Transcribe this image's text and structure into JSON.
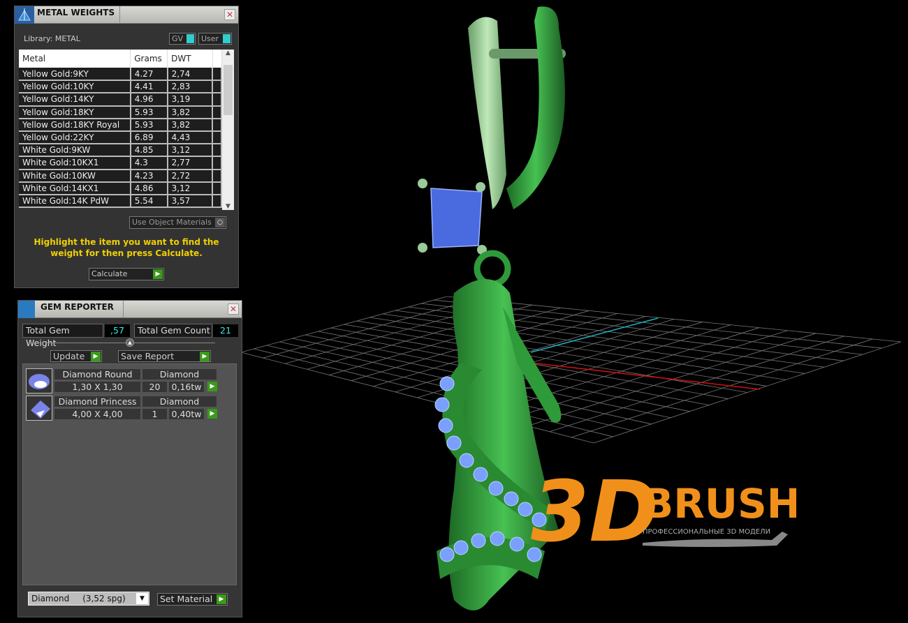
{
  "metal_weights": {
    "title": "METAL WEIGHTS",
    "close": "✕",
    "library_label": "Library: METAL",
    "toggle_gv": "GV",
    "toggle_user": "User",
    "columns": [
      "Metal",
      "Grams",
      "DWT"
    ],
    "rows": [
      [
        "Yellow Gold:9KY",
        "4.27",
        "2,74"
      ],
      [
        "Yellow Gold:10KY",
        "4.41",
        "2,83"
      ],
      [
        "Yellow Gold:14KY",
        "4.96",
        "3,19"
      ],
      [
        "Yellow Gold:18KY",
        "5.93",
        "3,82"
      ],
      [
        "Yellow Gold:18KY Royal",
        "5.93",
        "3,82"
      ],
      [
        "Yellow Gold:22KY",
        "6.89",
        "4,43"
      ],
      [
        "White Gold:9KW",
        "4.85",
        "3,12"
      ],
      [
        "White Gold:10KX1",
        "4.3",
        "2,77"
      ],
      [
        "White Gold:10KW",
        "4.23",
        "2,72"
      ],
      [
        "White Gold:14KX1",
        "4.86",
        "3,12"
      ],
      [
        "White Gold:14K PdW",
        "5.54",
        "3,57"
      ]
    ],
    "use_object_materials": "Use Object Materials",
    "hint": "Highlight the item you want to find the weight for then press Calculate.",
    "calculate": "Calculate"
  },
  "gem_reporter": {
    "title": "GEM REPORTER",
    "close": "✕",
    "total_weight_label": "Total Gem Weight",
    "total_weight": ",57",
    "total_count_label": "Total Gem Count",
    "total_count": "21",
    "update": "Update",
    "save_report": "Save Report",
    "gems": [
      {
        "name": "Diamond Round",
        "material": "Diamond",
        "size": "1,30 X 1,30",
        "count": "20",
        "weight": "0,16tw",
        "icon": "round-gem-icon"
      },
      {
        "name": "Diamond Princess",
        "material": "Diamond",
        "size": "4,00 X 4,00",
        "count": "1",
        "weight": "0,40tw",
        "icon": "princess-gem-icon"
      }
    ],
    "material_select": "Diamond     (3,52 spg)",
    "set_material": "Set Material"
  },
  "logo": {
    "text": "3D BRUSH",
    "tagline": "ПРОФЕССИОНАЛЬНЫЕ 3D МОДЕЛИ",
    "color": "#f0901a"
  },
  "colors": {
    "accent_green": "#3a9a1a",
    "value_cyan": "#33eeee",
    "hint_yellow": "#f0d000",
    "model_green": "#3fb24a",
    "gem_blue": "#6a8ff0"
  }
}
